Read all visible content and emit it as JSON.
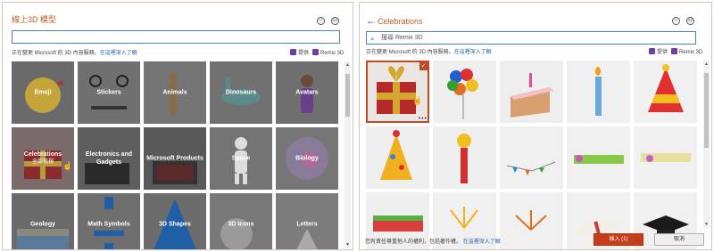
{
  "left": {
    "title": "線上3D 模型",
    "search": {
      "value": "",
      "placeholder": ""
    },
    "notice": {
      "text": "正在變更 Microsoft 的 3D 內容服務。",
      "link": "在這裡深入了解"
    },
    "provider": {
      "prefix": "提供",
      "name": "Remix 3D"
    },
    "categories": [
      {
        "label": "Emoji",
        "sub": ""
      },
      {
        "label": "Stickers",
        "sub": ""
      },
      {
        "label": "Animals",
        "sub": ""
      },
      {
        "label": "Dinosaurs",
        "sub": ""
      },
      {
        "label": "Avatars",
        "sub": ""
      },
      {
        "label": "Celebrations",
        "sub": "全部檢視"
      },
      {
        "label": "Electronics and Gadgets",
        "sub": ""
      },
      {
        "label": "Microsoft Products",
        "sub": ""
      },
      {
        "label": "Space",
        "sub": ""
      },
      {
        "label": "Biology",
        "sub": ""
      },
      {
        "label": "Geology",
        "sub": ""
      },
      {
        "label": "Math Symbols",
        "sub": ""
      },
      {
        "label": "3D Shapes",
        "sub": ""
      },
      {
        "label": "3D Icons",
        "sub": ""
      },
      {
        "label": "Letters",
        "sub": ""
      }
    ]
  },
  "right": {
    "title": "Celebrations",
    "search": {
      "value": "",
      "placeholder": "搜尋 Remix 3D"
    },
    "notice": {
      "text": "正在變更 Microsoft 的 3D 內容服務。",
      "link": "在這裡深入了解"
    },
    "provider": {
      "prefix": "提供",
      "name": "Remix 3D"
    },
    "models": [
      {
        "name": "gift box",
        "selected": true
      },
      {
        "name": "balloons",
        "selected": false
      },
      {
        "name": "birthday cake",
        "selected": false
      },
      {
        "name": "candle",
        "selected": false
      },
      {
        "name": "party hat",
        "selected": false
      },
      {
        "name": "party hat dotted",
        "selected": false
      },
      {
        "name": "party horn",
        "selected": false
      },
      {
        "name": "bunting",
        "selected": false
      },
      {
        "name": "flower banner",
        "selected": false
      },
      {
        "name": "floral banner",
        "selected": false
      },
      {
        "name": "flower wreath",
        "selected": false
      },
      {
        "name": "firework yellow",
        "selected": false
      },
      {
        "name": "firework orange",
        "selected": false
      },
      {
        "name": "diploma",
        "selected": false
      },
      {
        "name": "graduation cap",
        "selected": false
      }
    ],
    "footer_note": {
      "text": "您有責任尊重他人的權利，包括著作權。",
      "link": "在這裡深入了解"
    },
    "insert_label": "插入 (1)",
    "cancel_label": "取消"
  }
}
